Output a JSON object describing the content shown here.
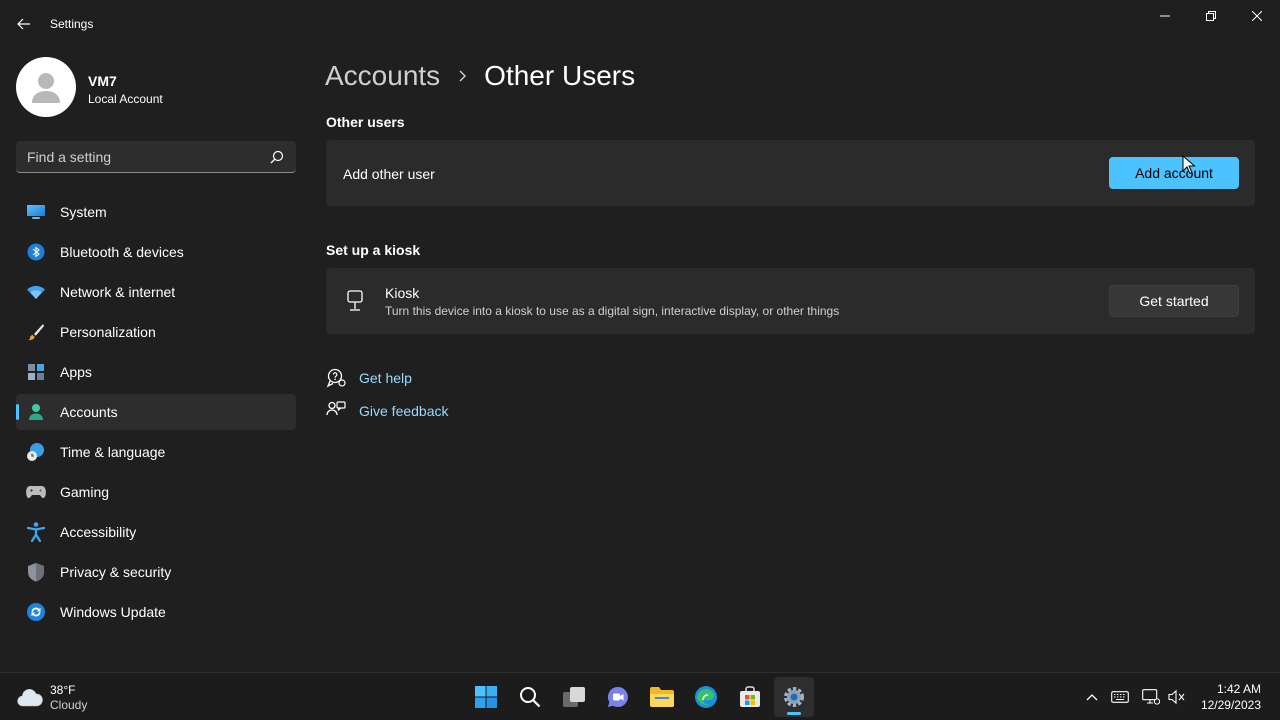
{
  "window": {
    "title": "Settings"
  },
  "profile": {
    "name": "VM7",
    "account_type": "Local Account"
  },
  "search": {
    "placeholder": "Find a setting"
  },
  "sidebar": {
    "items": [
      {
        "label": "System",
        "icon": "monitor-icon"
      },
      {
        "label": "Bluetooth & devices",
        "icon": "bluetooth-icon"
      },
      {
        "label": "Network & internet",
        "icon": "wifi-icon"
      },
      {
        "label": "Personalization",
        "icon": "brush-icon"
      },
      {
        "label": "Apps",
        "icon": "apps-icon"
      },
      {
        "label": "Accounts",
        "icon": "person-icon",
        "active": true
      },
      {
        "label": "Time & language",
        "icon": "globe-clock-icon"
      },
      {
        "label": "Gaming",
        "icon": "gamepad-icon"
      },
      {
        "label": "Accessibility",
        "icon": "accessibility-icon"
      },
      {
        "label": "Privacy & security",
        "icon": "shield-icon"
      },
      {
        "label": "Windows Update",
        "icon": "update-icon"
      }
    ]
  },
  "breadcrumb": {
    "parent": "Accounts",
    "current": "Other Users"
  },
  "other_users": {
    "section_title": "Other users",
    "row_label": "Add other user",
    "button_label": "Add account"
  },
  "kiosk": {
    "section_title": "Set up a kiosk",
    "title": "Kiosk",
    "description": "Turn this device into a kiosk to use as a digital sign, interactive display, or other things",
    "button_label": "Get started"
  },
  "links": {
    "get_help": "Get help",
    "give_feedback": "Give feedback"
  },
  "taskbar": {
    "weather_temp": "38°F",
    "weather_desc": "Cloudy",
    "time": "1:42 AM",
    "date": "12/29/2023"
  },
  "colors": {
    "accent": "#4cc2ff",
    "background": "#1f1f1f",
    "card": "#2b2b2b",
    "link": "#99d9ff"
  }
}
